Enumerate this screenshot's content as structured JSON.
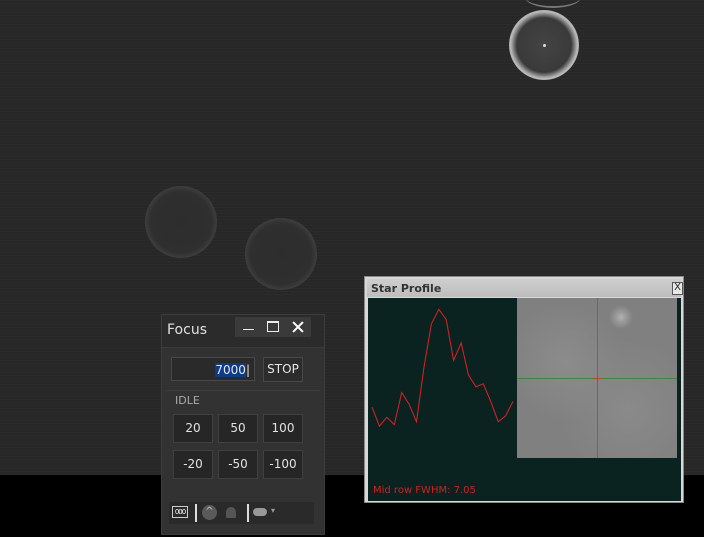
{
  "focus": {
    "title": "Focus",
    "position_value": "7000",
    "stop_label": "STOP",
    "status": "IDLE",
    "steps_out": [
      "20",
      "50",
      "100"
    ],
    "steps_in": [
      "-20",
      "-50",
      "-100"
    ]
  },
  "star_profile": {
    "title": "Star Profile",
    "close_glyph": "X",
    "fwhm_label": "Mid row FWHM: 7.05",
    "profile_color": "#e02020",
    "profile_values": [
      0.28,
      0.15,
      0.21,
      0.16,
      0.38,
      0.3,
      0.18,
      0.55,
      0.85,
      0.95,
      0.88,
      0.6,
      0.72,
      0.5,
      0.42,
      0.44,
      0.32,
      0.18,
      0.22,
      0.32
    ]
  },
  "toolbar": {
    "camera_glyph": "000",
    "up_glyph": "^"
  }
}
